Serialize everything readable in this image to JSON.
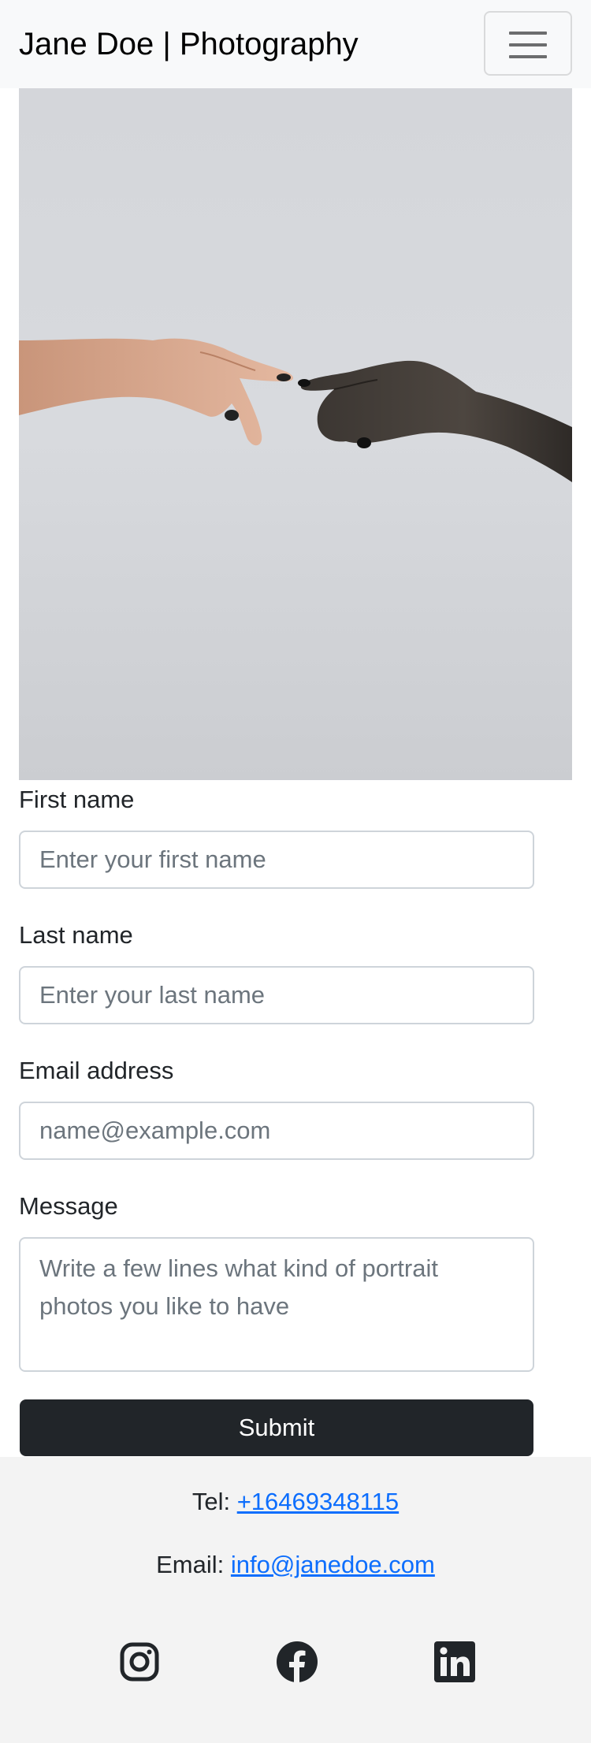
{
  "navbar": {
    "brand": "Jane Doe | Photography",
    "toggler_icon": "hamburger-menu-icon"
  },
  "hero": {
    "image_description_icon": "photo"
  },
  "form": {
    "first_name": {
      "label": "First name",
      "placeholder": "Enter your first name",
      "value": ""
    },
    "last_name": {
      "label": "Last name",
      "placeholder": "Enter your last name",
      "value": ""
    },
    "email": {
      "label": "Email address",
      "placeholder": "name@example.com",
      "value": ""
    },
    "message": {
      "label": "Message",
      "placeholder": "Write a few lines what kind of portrait photos you like to have",
      "value": ""
    },
    "submit_label": "Submit"
  },
  "footer": {
    "tel_label": "Tel:",
    "tel_value": "+16469348115",
    "email_label": "Email:",
    "email_value": "info@janedoe.com",
    "social": [
      "instagram-icon",
      "facebook-icon",
      "linkedin-icon"
    ]
  },
  "colors": {
    "navbar_bg": "#f8f9fa",
    "link": "#0d6efd",
    "button_bg": "#212529",
    "footer_bg": "#f3f3f3"
  }
}
